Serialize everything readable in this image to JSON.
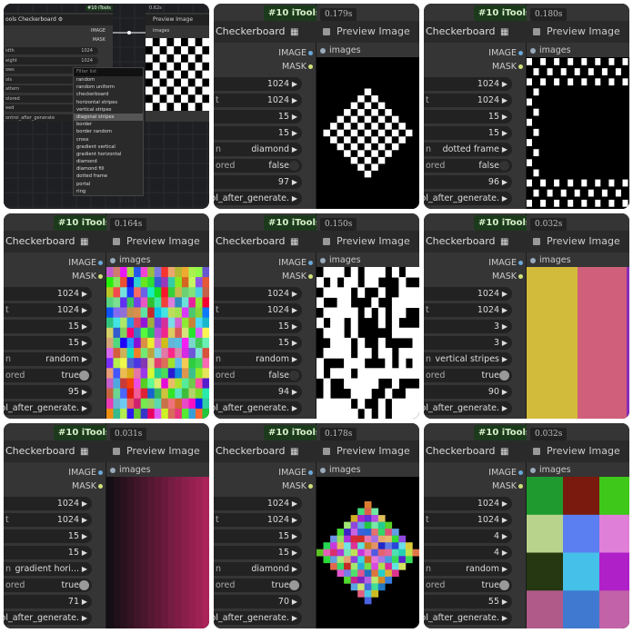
{
  "common": {
    "group_tag": "#10 iTools",
    "node_title": "Checkerboard",
    "checker_icon": "checkerboard-icon",
    "preview_title": "Preview Image",
    "out_image": "IMAGE",
    "out_mask": "MASK",
    "input_images": "images",
    "arrow": "▶",
    "label_n": "n",
    "label_ored": "ored",
    "label_t": "t",
    "cadence": "ol_after_generate."
  },
  "first": {
    "tag": "#10 iTools",
    "title": "ools Checkerboard",
    "time": "0.62s",
    "preview": "Preview Image",
    "out_image": "IMAGE",
    "out_mask": "MASK",
    "images": "images",
    "widgets": [
      "idth 1024",
      "eight 1024",
      "ows",
      "ols",
      "attern diagonal",
      "olored",
      "eed",
      "ontrol_after_generate"
    ],
    "w_labels": [
      "idth",
      "eight",
      "ows",
      "ols",
      "attern",
      "olored",
      "eed",
      "ontrol_after_generate"
    ],
    "w_values": [
      "1024",
      "1024",
      "",
      "",
      "diago",
      "",
      "",
      ""
    ],
    "filter": "Filter list",
    "menu": [
      "random",
      "random uniform",
      "checkerboard",
      "horizontal stripes",
      "vertical stripes",
      "diagonal stripes",
      "border",
      "border random",
      "cross",
      "gradient vertical",
      "gradient horizontal",
      "diamond",
      "diamond fill",
      "dotted frame",
      "portal",
      "ring"
    ],
    "selected": "diagonal stripes"
  },
  "cells": [
    {
      "time": "0.179s",
      "width": "1024",
      "height": "1024",
      "rows": "15",
      "cols": "15",
      "pattern": "diamond",
      "colored": "false",
      "seed": "97"
    },
    {
      "time": "0.180s",
      "width": "1024",
      "height": "1024",
      "rows": "15",
      "cols": "15",
      "pattern": "dotted frame",
      "colored": "false",
      "seed": "96"
    },
    {
      "time": "0.164s",
      "width": "1024",
      "height": "1024",
      "rows": "15",
      "cols": "15",
      "pattern": "random",
      "colored": "true",
      "seed": "95"
    },
    {
      "time": "0.150s",
      "width": "1024",
      "height": "1024",
      "rows": "15",
      "cols": "15",
      "pattern": "random",
      "colored": "false",
      "seed": "94"
    },
    {
      "time": "0.032s",
      "width": "1024",
      "height": "1024",
      "rows": "3",
      "cols": "3",
      "pattern": "vertical stripes",
      "colored": "true",
      "seed": "90"
    },
    {
      "time": "0.031s",
      "width": "1024",
      "height": "1024",
      "rows": "15",
      "cols": "15",
      "pattern": "gradient hori...",
      "colored": "true",
      "seed": "71"
    },
    {
      "time": "0.178s",
      "width": "1024",
      "height": "1024",
      "rows": "15",
      "cols": "15",
      "pattern": "diamond",
      "colored": "true",
      "seed": "70"
    },
    {
      "time": "0.032s",
      "width": "1024",
      "height": "1024",
      "rows": "4",
      "cols": "4",
      "pattern": "random",
      "colored": "true",
      "seed": "55"
    }
  ],
  "colors": {
    "panel": "#353535",
    "title": "#2a2a2a",
    "widget": "#222222",
    "tag_bg": "#1c3a1c"
  }
}
